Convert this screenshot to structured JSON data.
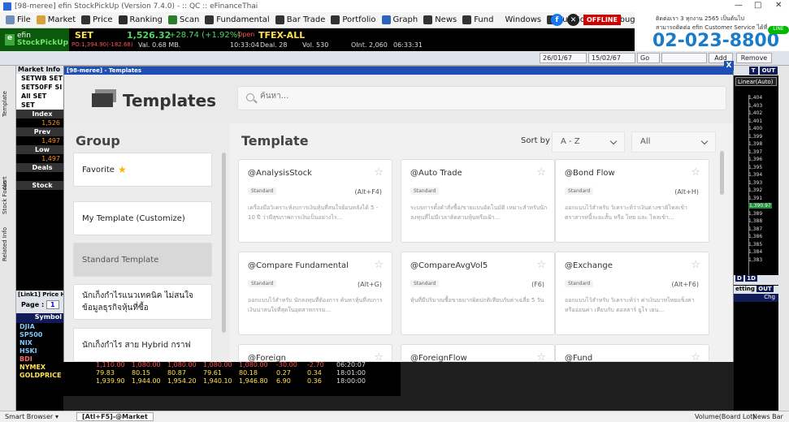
{
  "window": {
    "title": "[98-meree] efin StockPickUp (Version 7.4.0) - :: QC :: eFinanceThai"
  },
  "menu": [
    {
      "label": "File",
      "icon": "file-icon",
      "color": "#6d8fb8"
    },
    {
      "label": "Market",
      "icon": "market-icon",
      "color": "#d8a23a"
    },
    {
      "label": "Price",
      "icon": "price-icon",
      "color": "#333333"
    },
    {
      "label": "Ranking",
      "icon": "ranking-icon",
      "color": "#2c2c2c"
    },
    {
      "label": "Scan",
      "icon": "scan-icon",
      "color": "#2a7d2a"
    },
    {
      "label": "Fundamental",
      "icon": "fundamental-icon",
      "color": "#333333"
    },
    {
      "label": "Bar Trade",
      "icon": "bar-trade-icon",
      "color": "#333333"
    },
    {
      "label": "Portfolio",
      "icon": "portfolio-icon",
      "color": "#333333"
    },
    {
      "label": "Graph",
      "icon": "graph-icon",
      "color": "#2d63b8"
    },
    {
      "label": "News",
      "icon": "news-icon",
      "color": "#333333"
    },
    {
      "label": "Fund",
      "icon": "fund-icon",
      "color": "#333333"
    },
    {
      "label": "Windows",
      "icon": "",
      "color": ""
    },
    {
      "label": "Full Screen",
      "icon": "fullscreen-icon",
      "color": "#333333"
    },
    {
      "label": "Debug",
      "icon": "",
      "color": ""
    }
  ],
  "offline": "OFFLINE",
  "banner": {
    "line1": "ติดต่อเรา 3 ทุกงาน 2565 เป็นต้นไป",
    "line2": "สามารถติดต่อ efin Customer Service ได้ที่",
    "phone": "02-023-8800",
    "badge": "LINE"
  },
  "quote": {
    "logo_top": "efin",
    "logo_bottom": "StockPickUp",
    "symbol": "SET",
    "price": "1,526.32",
    "change": "+28.74 (+1.92%)",
    "sub": "PO:1,394.90(-182.68)",
    "volume_label": "Val. 0.68 MB.",
    "time": "10:33:04",
    "open_label": "Open",
    "tfex": "TFEX-ALL",
    "deal": "Deal. 28",
    "vol": "Vol. 530",
    "oint": "OInt. 2,060",
    "tfex_time": "06:33:31"
  },
  "toolbar": {
    "date1": "26/01/67",
    "date2": "15/02/67",
    "go": "Go",
    "add": "Add",
    "remove": "Remove"
  },
  "left_tabs": [
    "Template",
    "Alert",
    "Stock Focus",
    "Related Info"
  ],
  "market_panel": {
    "title": "Market Info",
    "rows": [
      {
        "text": "SETWB  SET",
        "cls": "lp-white"
      },
      {
        "text": "SET50FF  SI",
        "cls": "lp-white"
      },
      {
        "text": "All   SET",
        "cls": "lp-white"
      },
      {
        "text": "SET",
        "cls": "lp-white"
      },
      {
        "text": "Index",
        "cls": "lp-label"
      },
      {
        "text": "1,526",
        "cls": "lp-orange"
      },
      {
        "text": "Prev",
        "cls": "lp-label"
      },
      {
        "text": "1,497",
        "cls": "lp-orange"
      },
      {
        "text": "Low",
        "cls": "lp-label"
      },
      {
        "text": "1,497",
        "cls": "lp-orange"
      },
      {
        "text": "Deals",
        "cls": "lp-label"
      },
      {
        "text": "",
        "cls": "lp-orange"
      },
      {
        "text": "Stock",
        "cls": "lp-label"
      }
    ]
  },
  "link1": {
    "title": "[Link1] Price H",
    "page_label": "Page :",
    "page_value": "1",
    "symbol_header": "Symbol",
    "symbols": [
      {
        "name": "DJIA",
        "color": "#7ec8ff"
      },
      {
        "name": "SP500",
        "color": "#7ec8ff"
      },
      {
        "name": "NIX",
        "color": "#7ec8ff"
      },
      {
        "name": "HSKI",
        "color": "#7ec8ff"
      },
      {
        "name": "BDI",
        "color": "#ff6a6a"
      },
      {
        "name": "NYMEX",
        "color": "#ffe14d"
      },
      {
        "name": "GOLDPRICE",
        "color": "#ffe14d"
      }
    ]
  },
  "market_rows": [
    {
      "cells": [
        "1,110.00",
        "1,080.00",
        "1,080.00",
        "1,080.00",
        "1,080.00",
        "-30.00",
        "-2.70",
        "06:20:07"
      ],
      "color": "#ff5050"
    },
    {
      "cells": [
        "79.83",
        "80.15",
        "80.87",
        "79.61",
        "80.18",
        "0.27",
        "0.34",
        "18:01:00"
      ],
      "color": "#ffe14d"
    },
    {
      "cells": [
        "1,939.90",
        "1,944.00",
        "1,954.20",
        "1,940.10",
        "1,946.80",
        "6.90",
        "0.36",
        "18:00:00"
      ],
      "color": "#ffe14d"
    }
  ],
  "right_panel": {
    "t_label": "T",
    "out_label": "OUT",
    "mode": "Linear(Auto)",
    "ticks": [
      "1,404",
      "1,403",
      "1,402",
      "1,401",
      "1,400",
      "1,399",
      "1,398",
      "1,397",
      "1,396",
      "1,395",
      "1,394",
      "1,393",
      "1,392",
      "1,391",
      "1,390.97",
      "1,389",
      "1,388",
      "1,387",
      "1,386",
      "1,385",
      "1,384",
      "1,383"
    ],
    "d_label": "D",
    "one_d": "1D",
    "setting": "etting",
    "out2": "OUT",
    "chg": "Chg"
  },
  "status": {
    "smart_browser": "Smart Browser",
    "tab": "[Atl+F5]-@Market",
    "volume": "Volume(Board Lot)",
    "newsbar": "News Bar"
  },
  "modal": {
    "window_title": "[98-meree] - Templates",
    "close": "X",
    "title": "Templates",
    "search_placeholder": "ค้นหา...",
    "group_heading": "Group",
    "groups": [
      {
        "label": "Favorite",
        "star": "★",
        "active": false
      },
      {
        "label": "My Template (Customize)",
        "active": false
      },
      {
        "label": "Standard Template",
        "active": true
      },
      {
        "label": "นักเก็งกำไรแนวเทคนิค ไม่สนใจ ข้อมูลธุรกิจหุ้นที่ซื้อ",
        "active": false
      },
      {
        "label": "นักเก็งกำไร สาย Hybrid กราฟ",
        "active": false
      }
    ],
    "template_heading": "Template",
    "sort_label": "Sort by",
    "sort_value": "A - Z",
    "filter_value": "All",
    "cards": [
      {
        "title": "@AnalysisStock",
        "tag": "Standard",
        "key": "(Alt+F4)",
        "desc": "เครื่องมือวิเคราะห์งบการเงินหุ้นที่สนใจย้อนหลังได้ 5 - 10 ปี ว่ามีสุขภาพการเงินเป็นอย่างไร..."
      },
      {
        "title": "@Auto Trade",
        "tag": "Standard",
        "key": "",
        "desc": "ระบบการตั้งคำสั่งซื้อ/ขายแบบอัตโนมัติ เหมาะสำหรับนักลงทุนที่ไม่มีเวลาติดตามหุ้นหรือเฝ้า..."
      },
      {
        "title": "@Bond Flow",
        "tag": "Standard",
        "key": "(Alt+H)",
        "desc": "ออกแบบไว้สำหรับ วิเคราะห์ว่าเงินต่างชาติไหลเข้า ตราสารหนี้ระยะสั้น หรือ ไทย และ ไหลเข้า..."
      },
      {
        "title": "@Compare Fundamental",
        "tag": "Standard",
        "key": "(Alt+G)",
        "desc": "ออกแบบไว้สำหรับ นักลงทุนที่ต้องการ ค้นหาหุ้นที่งบการเงินน่าสนใจที่สุดในอุตสาหกรรม..."
      },
      {
        "title": "@CompareAvgVol5",
        "tag": "Standard",
        "key": "(F6)",
        "desc": "หุ้นที่มีปริมาณซื้อขายมากผิดปกติเทียบกับค่าเฉลี่ย 5 วัน"
      },
      {
        "title": "@Exchange",
        "tag": "Standard",
        "key": "(Alt+F6)",
        "desc": "ออกแบบไว้สำหรับ วิเคราะห์ว่า ค่าเงินบาทไทยแข็งค่าหรืออ่อนค่า เทียบกับ ดอลลาร์ ยูโร เยน..."
      },
      {
        "title": "@Foreign",
        "tag": "",
        "key": "",
        "desc": ""
      },
      {
        "title": "@ForeignFlow",
        "tag": "",
        "key": "",
        "desc": ""
      },
      {
        "title": "@Fund",
        "tag": "",
        "key": "",
        "desc": ""
      }
    ]
  }
}
